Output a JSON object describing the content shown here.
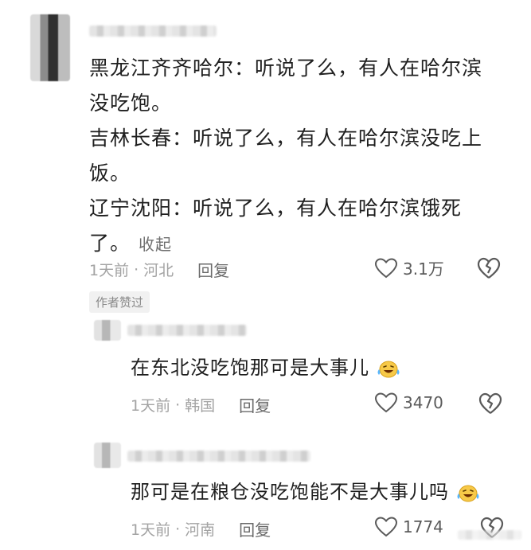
{
  "comment": {
    "lines": [
      "黑龙江齐齐哈尔：听说了么，有人在哈尔滨",
      "没吃饱。",
      "吉林长春：听说了么，有人在哈尔滨没吃上",
      "饭。",
      "辽宁沈阳：听说了么，有人在哈尔滨饿死",
      "了。"
    ],
    "collapse_label": "收起",
    "time": "1天前",
    "location": "河北",
    "reply_label": "回复",
    "likes": "3.1万",
    "badge": "作者赞过"
  },
  "replies": [
    {
      "text": "在东北没吃饱那可是大事儿",
      "emoji": "laughing-tears-emoji",
      "time": "1天前",
      "location": "韩国",
      "reply_label": "回复",
      "likes": "3470"
    },
    {
      "text": "那可是在粮仓没吃饱能不是大事儿吗",
      "emoji": "laughing-tears-emoji",
      "time": "1天前",
      "location": "河南",
      "reply_label": "回复",
      "likes": "1774"
    }
  ],
  "icons": {
    "like": "heart-icon",
    "dislike": "broken-heart-icon"
  },
  "colors": {
    "text": "#1f1f1f",
    "meta": "#a3a3a3",
    "icon": "#6a6a6a"
  }
}
